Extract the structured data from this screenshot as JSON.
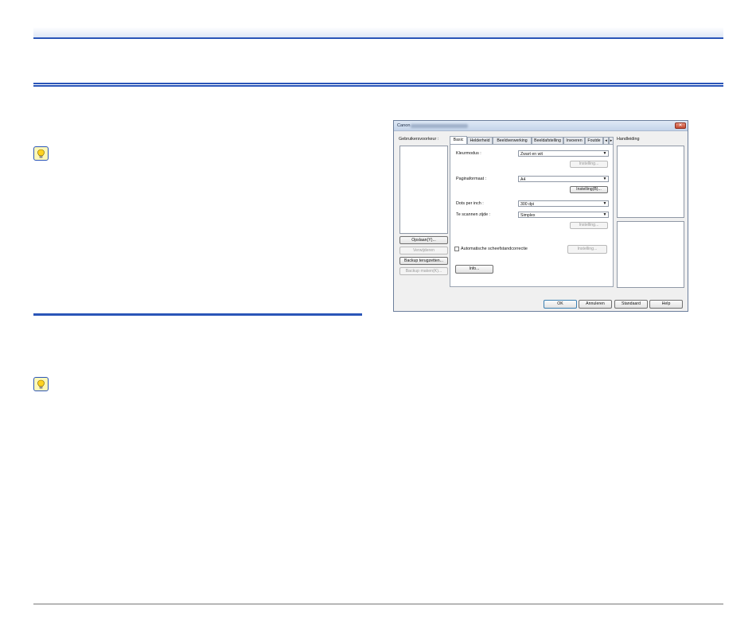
{
  "dialog": {
    "title": "Canon",
    "close_label": "✕",
    "left": {
      "label": "Gebruikersvoorkeur :",
      "buttons": [
        "Opslaan(Y)...",
        "Verwijderen",
        "Backup terugzetten...",
        "Backup maken(K)..."
      ]
    },
    "tabs": [
      "Basic",
      "Helderheid",
      "Beeldverwerking",
      "Beeldafstelling",
      "Invoeren",
      "Foutde"
    ],
    "tab_nav": [
      "◂",
      "▸"
    ],
    "basic": {
      "color_mode_label": "Kleurmodus :",
      "color_mode_value": "Zwart en wit",
      "page_size_label": "Paginaformaat :",
      "page_size_value": "A4",
      "dpi_label": "Dots per inch :",
      "dpi_value": "300 dpi",
      "side_label": "Te scannen zijde :",
      "side_value": "Simplex",
      "settings_label": "Instelling...",
      "settings_b_label": "Instelling(B)...",
      "skew_label": "Automatische scheefstandcorrectie",
      "info_label": "Info..."
    },
    "help_panel_label": "Handleiding",
    "footer": {
      "ok": "OK",
      "cancel": "Annuleren",
      "default": "Standaard",
      "help": "Help"
    }
  }
}
